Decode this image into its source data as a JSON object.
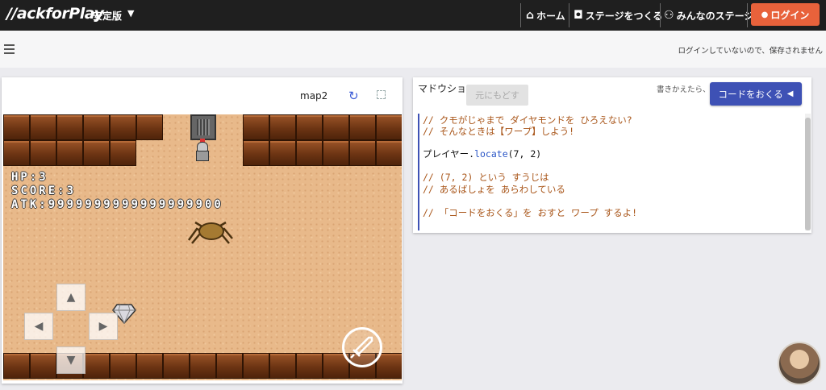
{
  "header": {
    "logo": "//ackforPlay",
    "version": "安定版",
    "version_caret": "▼",
    "nav": [
      {
        "icon": "⌂",
        "label": "ホーム"
      },
      {
        "icon": "◘",
        "label": "ステージをつくる"
      },
      {
        "icon": "⚇",
        "label": "みんなのステージ"
      }
    ],
    "login": {
      "icon": "●",
      "label": "ログイン"
    },
    "colors": {
      "bar": "#1f1f1f",
      "login": "#e8623b"
    }
  },
  "subbar": {
    "save_notice": "ログインしていないので、保存されません"
  },
  "game": {
    "map_name": "map2",
    "hud": {
      "hp": "HP:3",
      "score": "SCORE:3",
      "atk": "ATK:9999999999999999900"
    },
    "dpad": {
      "up": "▲",
      "left": "◀",
      "right": "▶",
      "down": "▼"
    }
  },
  "code_panel": {
    "file_label": "マドウショ",
    "undo_label": "元にもどす",
    "hint": "書きかえたら、",
    "send_label": "コードをおくる",
    "send_icon": "◀",
    "accent": "#3e51b5",
    "lines": [
      {
        "kind": "comment",
        "text": "// クモがじゃまで ダイヤモンドを ひろえない?"
      },
      {
        "kind": "comment",
        "text": "// そんなときは【ワープ】しよう!"
      },
      {
        "kind": "code",
        "prefix": "プレイヤー.",
        "fn": "locate",
        "args": "(7, 2)"
      },
      {
        "kind": "comment",
        "text": "// (7, 2) という すうじは"
      },
      {
        "kind": "comment",
        "text": "// あるばしょを あらわしている"
      },
      {
        "kind": "comment",
        "text": "// 「コードをおくる」を おすと ワープ するよ!"
      }
    ]
  }
}
